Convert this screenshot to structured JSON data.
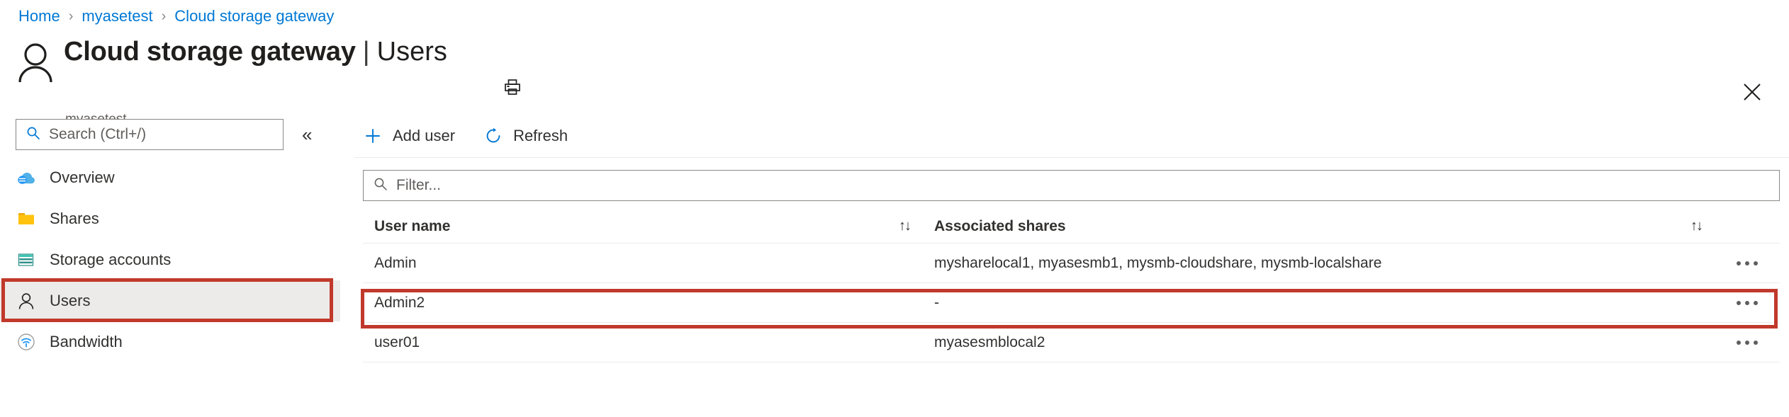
{
  "breadcrumb": {
    "items": [
      "Home",
      "myasetest",
      "Cloud storage gateway"
    ],
    "separator": "›"
  },
  "header": {
    "title": "Cloud storage gateway",
    "title_separator": "|",
    "title_section": "Users",
    "subtitle": "myasetest",
    "print_icon": "print-icon",
    "close_icon": "close-icon",
    "avatar_icon": "user-avatar-icon"
  },
  "sidebar": {
    "search": {
      "placeholder": "Search (Ctrl+/)",
      "value": "",
      "icon": "search-icon"
    },
    "collapse_label": "«",
    "items": [
      {
        "label": "Overview",
        "icon": "cloud-icon",
        "selected": false
      },
      {
        "label": "Shares",
        "icon": "folder-icon",
        "selected": false
      },
      {
        "label": "Storage accounts",
        "icon": "storage-account-icon",
        "selected": false
      },
      {
        "label": "Users",
        "icon": "user-icon",
        "selected": true
      },
      {
        "label": "Bandwidth",
        "icon": "bandwidth-icon",
        "selected": false
      }
    ]
  },
  "toolbar": {
    "add_user_label": "Add user",
    "add_user_icon": "plus-icon",
    "refresh_label": "Refresh",
    "refresh_icon": "refresh-icon"
  },
  "filter": {
    "placeholder": "Filter...",
    "value": "",
    "icon": "search-icon"
  },
  "table": {
    "columns": [
      {
        "label": "User name",
        "sort_icon": "↑↓"
      },
      {
        "label": "Associated shares",
        "sort_icon": "↑↓"
      }
    ],
    "rows": [
      {
        "user_name": "Admin",
        "associated_shares": "mysharelocal1, myasesmb1, mysmb-cloudshare, mysmb-localshare",
        "actions_icon": "ellipsis-icon",
        "highlighted": false
      },
      {
        "user_name": "Admin2",
        "associated_shares": "-",
        "actions_icon": "ellipsis-icon",
        "highlighted": true
      },
      {
        "user_name": "user01",
        "associated_shares": "myasesmblocal2",
        "actions_icon": "ellipsis-icon",
        "highlighted": false
      }
    ]
  },
  "annotations": {
    "highlight_color": "#c0392b",
    "targets": [
      "sidebar-item-users",
      "table-row-admin2"
    ]
  },
  "colors": {
    "link": "#0078d4",
    "accent": "#0078d4",
    "selected_row_bg": "#edebe9",
    "text": "#323130",
    "muted_text": "#605e5c"
  }
}
